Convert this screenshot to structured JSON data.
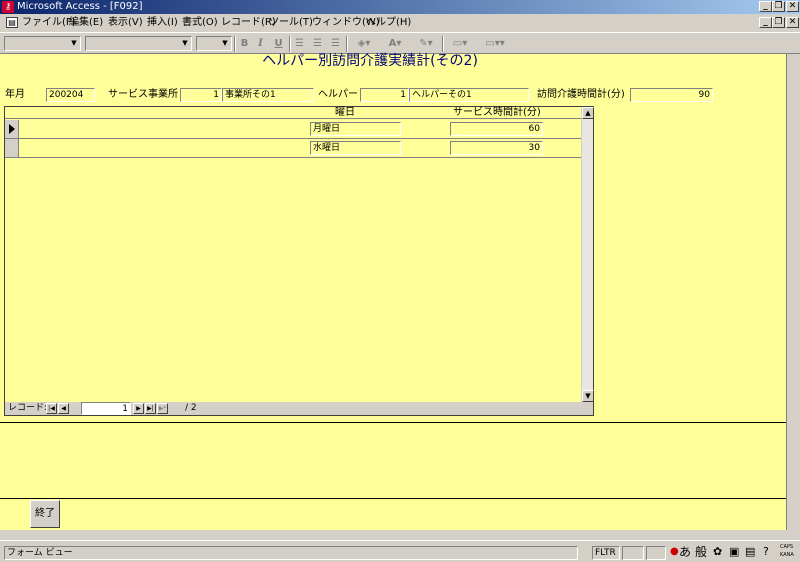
{
  "window": {
    "app_icon": "access-key-icon",
    "title": "Microsoft Access - [F092]"
  },
  "menu": [
    {
      "label": "ファイル(F)"
    },
    {
      "label": "編集(E)"
    },
    {
      "label": "表示(V)"
    },
    {
      "label": "挿入(I)"
    },
    {
      "label": "書式(O)"
    },
    {
      "label": "レコード(R)"
    },
    {
      "label": "ツール(T)"
    },
    {
      "label": "ウィンドウ(W)"
    },
    {
      "label": "ヘルプ(H)"
    }
  ],
  "toolbar": {
    "bold": "B",
    "italic": "I",
    "underline": "U"
  },
  "form": {
    "title": "ヘルパー別訪問介護実績計(その2)",
    "year_month_label": "年月",
    "year_month_value": "200204",
    "office_label": "サービス事業所",
    "office_id": "1",
    "office_name": "事業所その1",
    "helper_label": "ヘルパー",
    "helper_id": "1",
    "helper_name": "ヘルパーその1",
    "total_label": "訪問介護時間計(分)",
    "total_value": "90",
    "close_button": "終了"
  },
  "subform": {
    "columns": [
      "曜日",
      "サービス時間計(分)"
    ],
    "rows": [
      {
        "day": "月曜日",
        "minutes": "60"
      },
      {
        "day": "水曜日",
        "minutes": "30"
      }
    ],
    "nav": {
      "label": "レコード:",
      "current": "1",
      "total": "/ 2"
    }
  },
  "status": {
    "view": "フォーム ビュー",
    "filter": "FLTR",
    "ime_mode": "あ",
    "ime_conv": "般",
    "caps": "CAPS",
    "kana": "KANA"
  },
  "colors": {
    "form_bg": "#ffff99",
    "title_color": "#000080",
    "titlebar_start": "#0a246a"
  }
}
